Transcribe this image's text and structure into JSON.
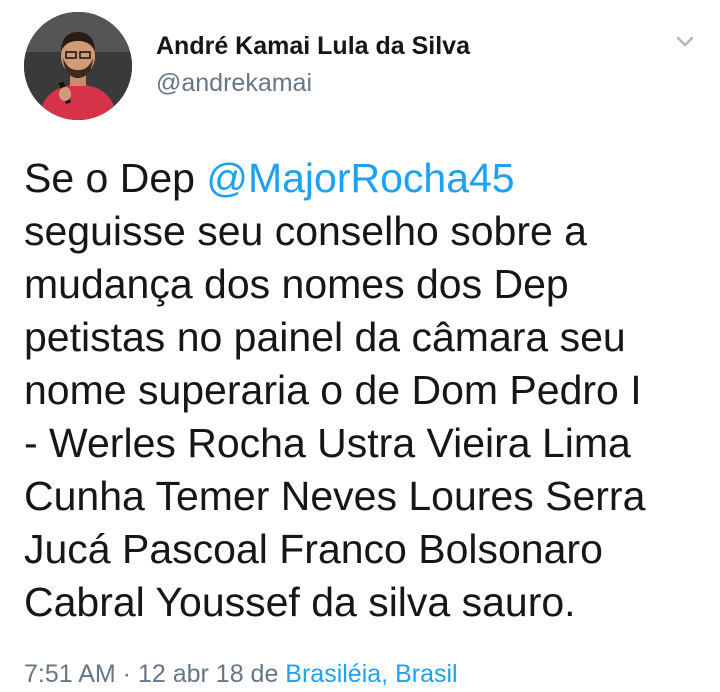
{
  "author": {
    "display_name": "André Kamai Lula da Silva",
    "handle": "@andrekamai"
  },
  "tweet": {
    "line1_prefix": "Se o Dep ",
    "mention": "@MajorRocha45",
    "lines": [
      "seguisse seu conselho sobre a",
      "mudança dos nomes dos Dep",
      "petistas no painel da câmara seu",
      "nome superaria o de Dom Pedro I",
      "- Werles Rocha Ustra Vieira Lima",
      "Cunha Temer Neves Loures Serra",
      "Jucá Pascoal Franco Bolsonaro",
      "Cabral Youssef da silva sauro."
    ]
  },
  "meta": {
    "time": "7:51 AM",
    "separator": " · ",
    "date": "12 abr 18",
    "from": " de ",
    "location": "Brasiléia, Brasil"
  },
  "icons": {
    "avatar": "profile-photo",
    "menu": "chevron-down-icon"
  },
  "colors": {
    "text": "#14171a",
    "secondary": "#657786",
    "link": "#1da1f2"
  }
}
